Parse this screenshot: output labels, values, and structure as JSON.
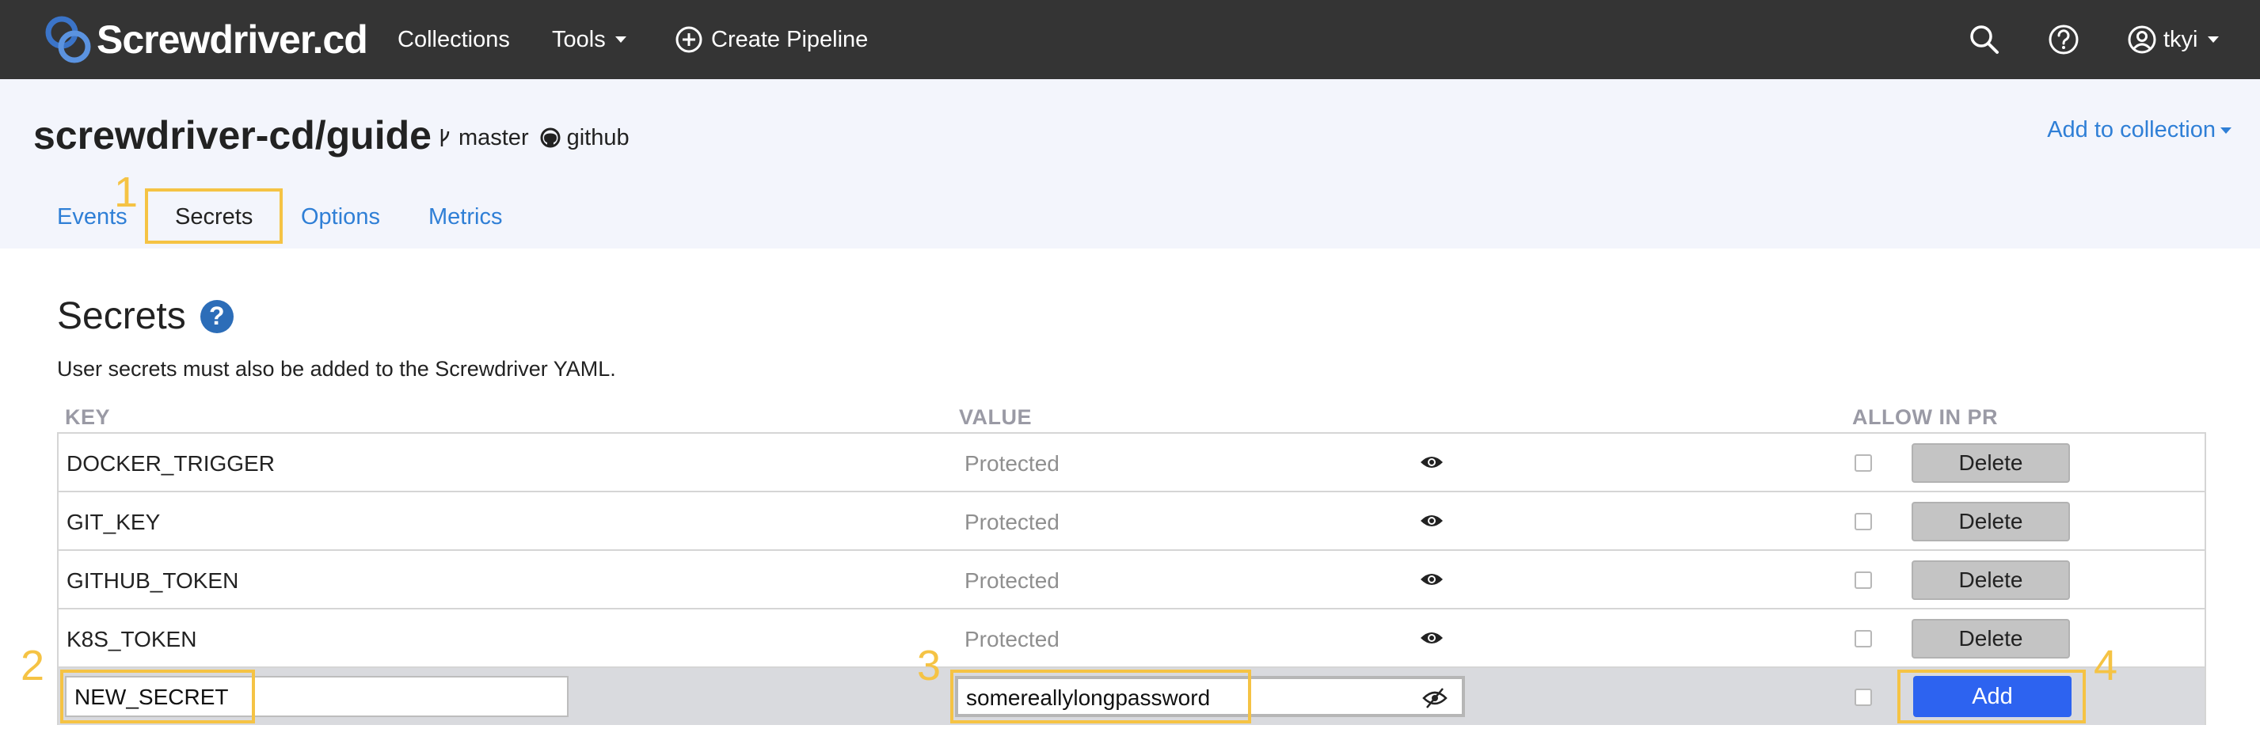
{
  "brand": {
    "name": "Screwdriver.cd"
  },
  "nav": {
    "collections": "Collections",
    "tools": "Tools",
    "create_pipeline": "Create Pipeline",
    "user": "tkyi"
  },
  "repo": {
    "name": "screwdriver-cd/guide",
    "branch": "master",
    "scm": "github"
  },
  "header": {
    "add_to_collection": "Add to collection"
  },
  "tabs": [
    {
      "label": "Events"
    },
    {
      "label": "Secrets"
    },
    {
      "label": "Options"
    },
    {
      "label": "Metrics"
    }
  ],
  "active_tab": "Secrets",
  "secrets": {
    "title": "Secrets",
    "help": "?",
    "description": "User secrets must also be added to the Screwdriver YAML.",
    "columns": {
      "key": "KEY",
      "value": "VALUE",
      "allow_in_pr": "ALLOW IN PR"
    },
    "rows": [
      {
        "key": "DOCKER_TRIGGER",
        "value": "Protected",
        "allow_in_pr": false,
        "action": "Delete"
      },
      {
        "key": "GIT_KEY",
        "value": "Protected",
        "allow_in_pr": false,
        "action": "Delete"
      },
      {
        "key": "GITHUB_TOKEN",
        "value": "Protected",
        "allow_in_pr": false,
        "action": "Delete"
      },
      {
        "key": "K8S_TOKEN",
        "value": "Protected",
        "allow_in_pr": false,
        "action": "Delete"
      }
    ],
    "new_row": {
      "key_value": "NEW_SECRET",
      "value_value": "somereallylongpassword",
      "allow_in_pr": false,
      "add_label": "Add"
    }
  },
  "annotations": {
    "n1": "1",
    "n2": "2",
    "n3": "3",
    "n4": "4"
  },
  "colors": {
    "nav_bg": "#343434",
    "header_bg": "#f3f5fc",
    "link": "#2f7fd6",
    "highlight": "#f5c344",
    "add_button": "#2d63f0",
    "delete_button": "#c4c4c4"
  }
}
